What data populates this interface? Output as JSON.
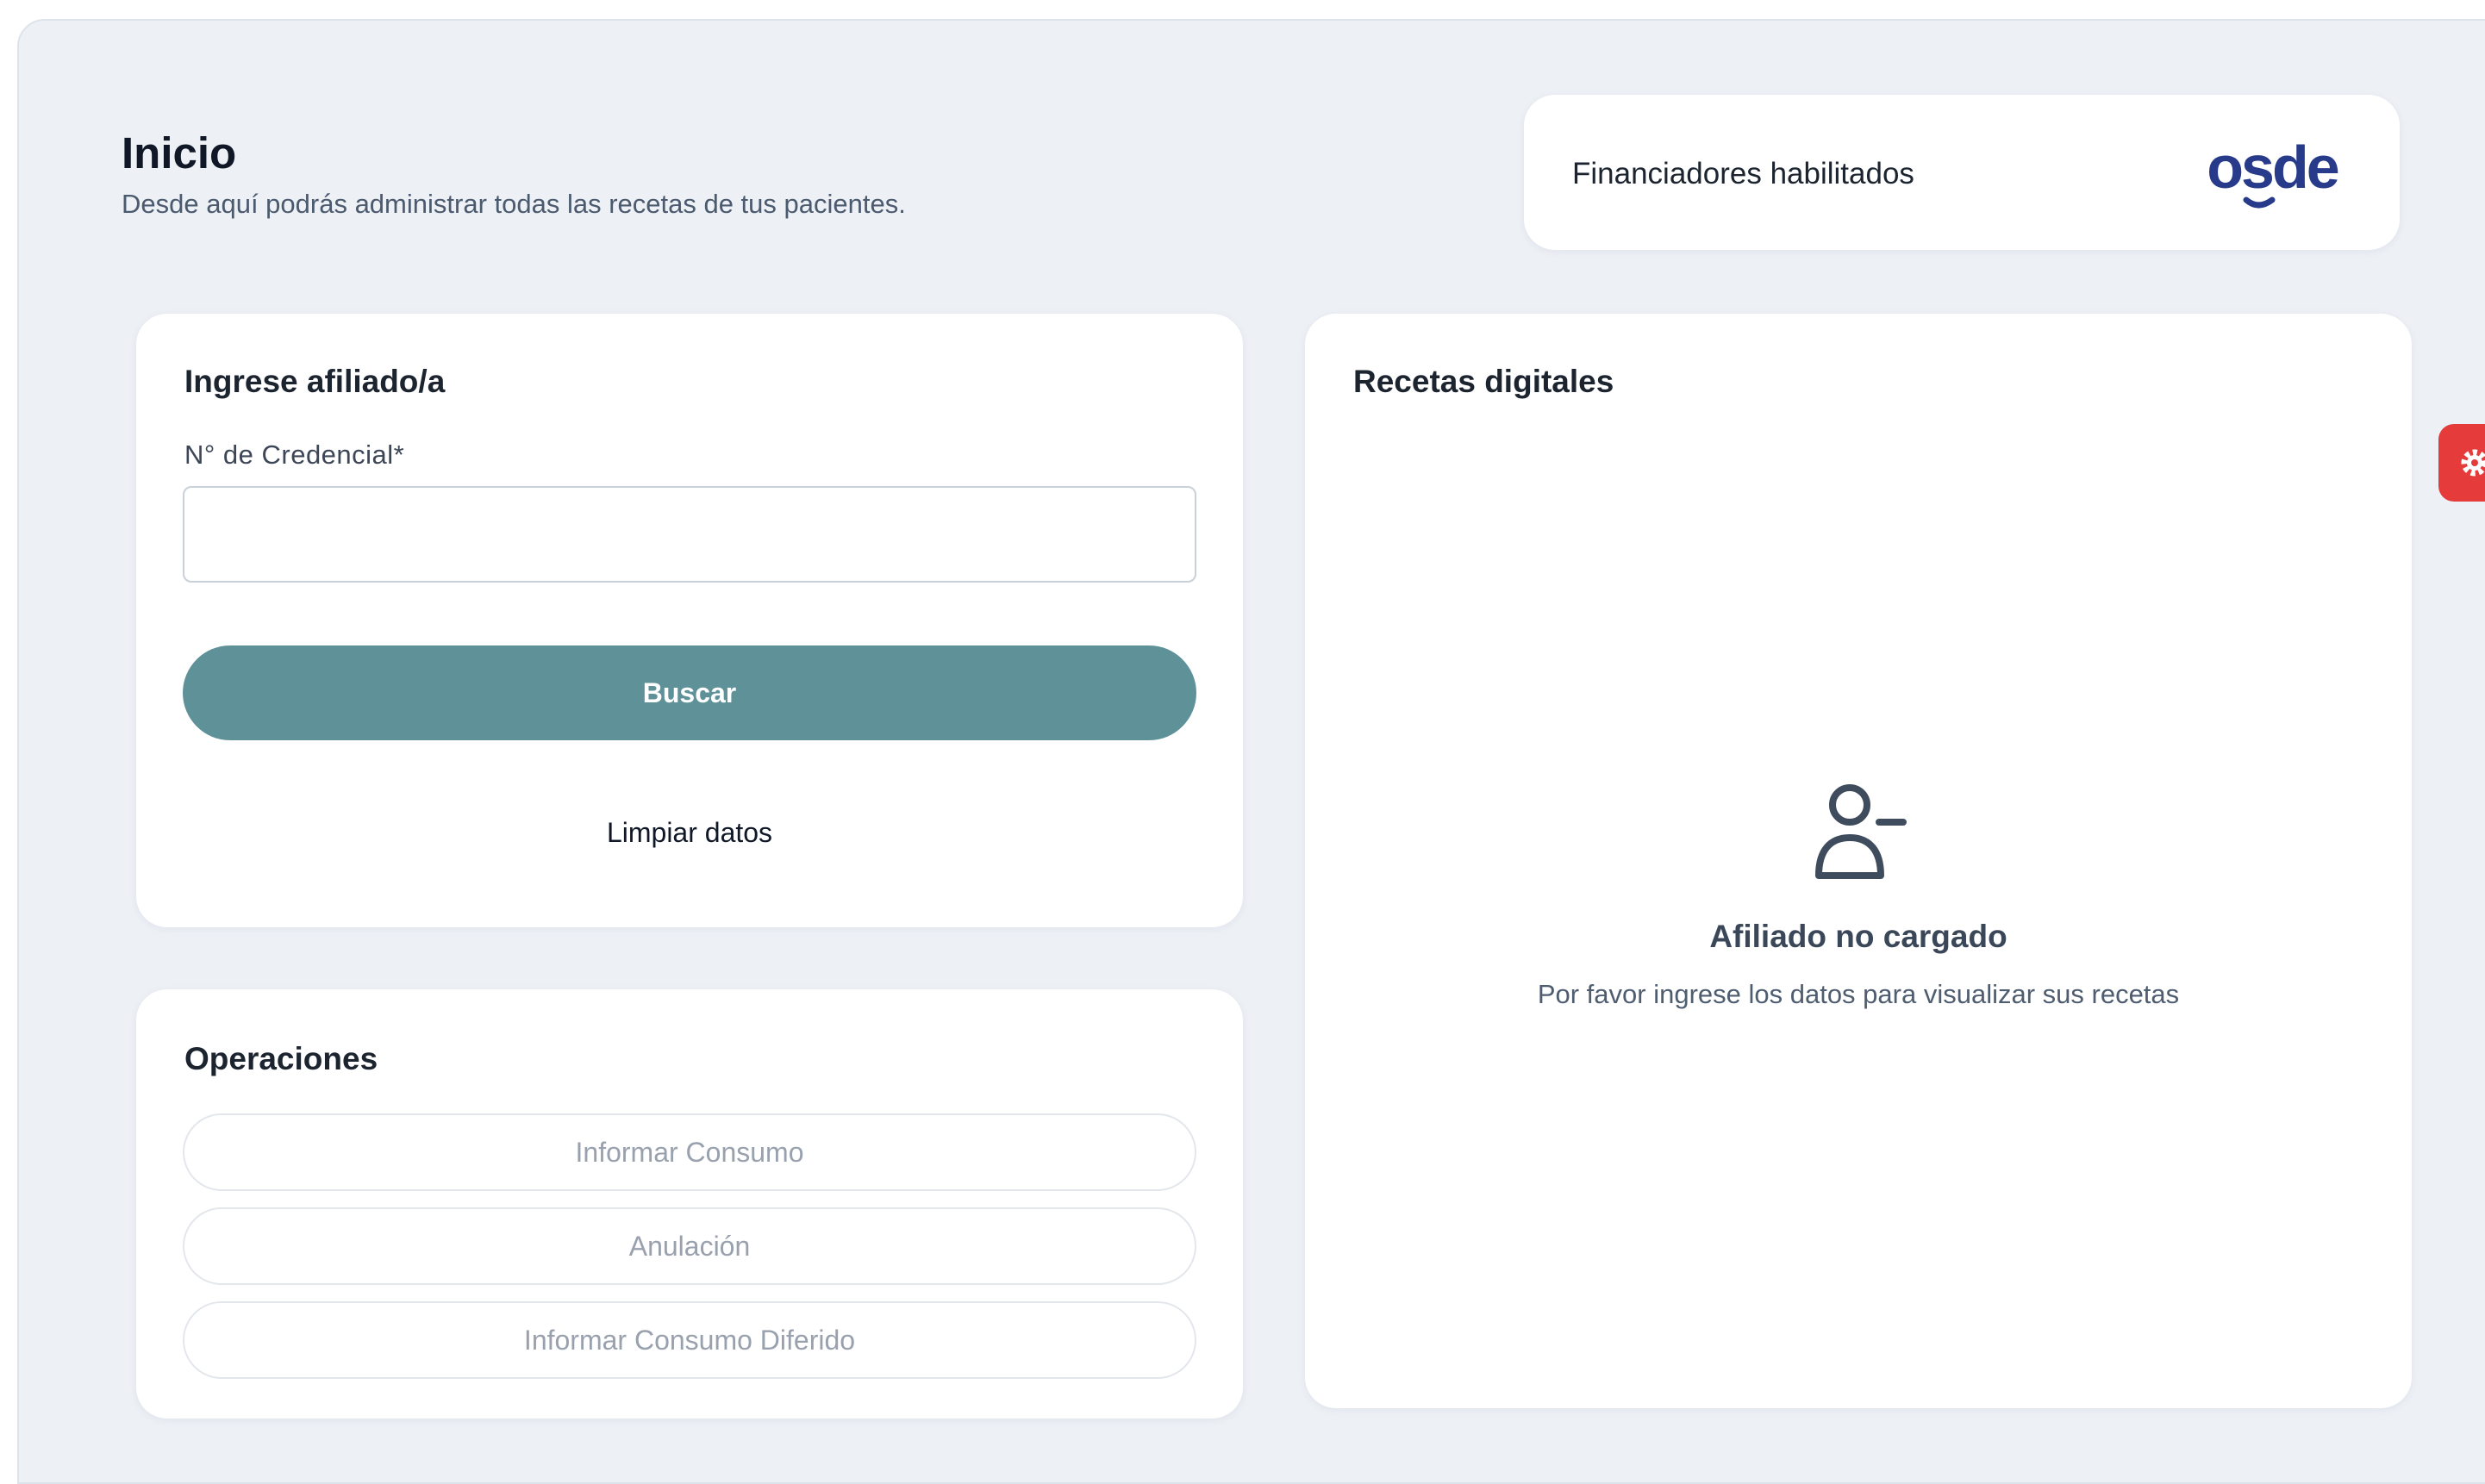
{
  "header": {
    "title": "Inicio",
    "subtitle": "Desde aquí podrás administrar todas las recetas de tus pacientes."
  },
  "financiadores": {
    "label": "Financiadores habilitados",
    "logo_text": "osde",
    "logo_color": "#283b8a"
  },
  "afiliado": {
    "heading": "Ingrese afiliado/a",
    "credencial_label": "N° de Credencial*",
    "credencial_value": "",
    "buscar_label": "Buscar",
    "limpiar_label": "Limpiar datos"
  },
  "operaciones": {
    "heading": "Operaciones",
    "items": [
      {
        "label": "Informar Consumo"
      },
      {
        "label": "Anulación"
      },
      {
        "label": "Informar Consumo Diferido"
      }
    ]
  },
  "recetas": {
    "heading": "Recetas digitales",
    "empty_icon": "user-minus-icon",
    "empty_title": "Afiliado no cargado",
    "empty_description": "Por favor ingrese los datos para visualizar sus recetas"
  },
  "settings": {
    "icon": "gear-icon",
    "color": "#e53b3b"
  },
  "colors": {
    "primary_button": "#5f9199",
    "page_background": "#edf1f6"
  }
}
